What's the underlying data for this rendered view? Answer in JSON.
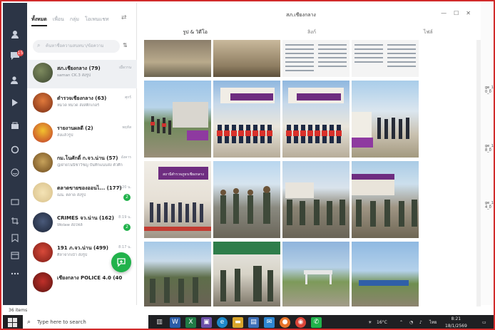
{
  "colors": {
    "rail": "#2c3546",
    "accent_green": "#21b24b",
    "frame_red": "#d12b2b",
    "taskbar": "#1f2023"
  },
  "rail": {
    "icons": [
      "person-icon",
      "chat-icon",
      "add-friend-icon",
      "play-icon",
      "shop-icon",
      "voom-icon",
      "emoji-icon",
      "screen-share-icon",
      "crop-icon",
      "bookmark-icon",
      "calendar-icon",
      "more-icon"
    ],
    "chat_badge": "15"
  },
  "chat_tabs": [
    "ทั้งหมด",
    "เพื่อน",
    "กลุ่ม",
    "โอเพนแชท"
  ],
  "search_placeholder": "ค้นหาชื่อความสนทนา/ข้อความ",
  "chats": [
    {
      "name": "สภ.เชียงกลาง (79)",
      "preview": "saman CK.3 ส่งรูป",
      "time": "เมื่อวาน"
    },
    {
      "name": "ตำรวจเชียงกลาง (63)",
      "preview": "หมวด หมวด ส่งสติกเกอร์",
      "time": "ศุกร์"
    },
    {
      "name": "รายงานผลดี (2)",
      "preview": "ส่งแล้วรูป",
      "time": "พฤหัส"
    },
    {
      "name": "กม.โนศักดิ์ ก.จว.น่าน (57)",
      "preview": "@ฝ่ายโนนีชาวิชญ บันทึกแนบส่ง ตัวศึกษาทำหน้า 1 ฉุดดึงให้คนแนน...",
      "time": "อังคาร"
    },
    {
      "name": "ตลาดขายของออนไ... (177)",
      "preview": "ณน. ตลาด ส่งรูป",
      "time": "8:20 น.",
      "unread": "2"
    },
    {
      "name": "CRIMES จว.น่าน (162)",
      "preview": "Wolaw ส่งไฟล์",
      "time": "8:19 น.",
      "unread": "2"
    },
    {
      "name": "191 ภ.จว.น่าน (499)",
      "preview": "ศิลาจากเบ้า ส่งรูป",
      "time": "8:17 น."
    },
    {
      "name": "เชียงกลาง POLICE 4.0 (40)",
      "preview": "",
      "time": ""
    }
  ],
  "gallery": {
    "title": "สภ.เชียงกลาง",
    "tabs": [
      "รูป & วิดีโอ",
      "ลิงก์",
      "ไฟล์"
    ],
    "banner_text": "สถานีตำรวจภูธรเชียงกลาง",
    "items_count": "36 items"
  },
  "behind_window": {
    "labels": [
      "ge_1",
      "ge_1",
      "ge_1"
    ],
    "sublabels": [
      "0_0",
      "8_0",
      "4_0"
    ]
  },
  "taskbar": {
    "search_placeholder": "Type here to search",
    "weather": "16°C",
    "lang": "ไทย",
    "time": "8:21",
    "date": "18/1/2569"
  }
}
